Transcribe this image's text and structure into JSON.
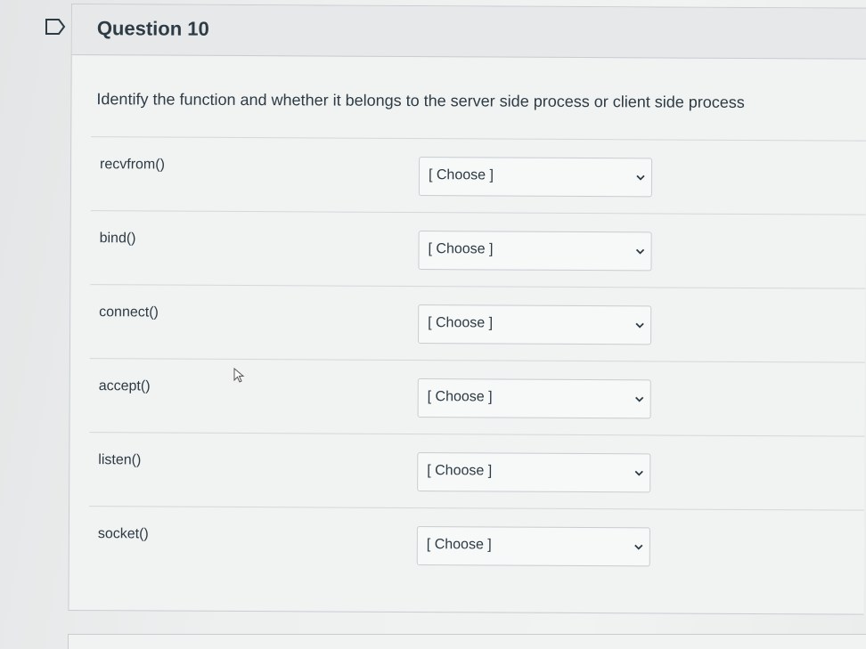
{
  "question": {
    "title": "Question 10",
    "prompt": "Identify the function and whether it belongs to the server side process or client side process"
  },
  "rows": [
    {
      "label": "recvfrom()",
      "selected": "[ Choose ]"
    },
    {
      "label": "bind()",
      "selected": "[ Choose ]"
    },
    {
      "label": "connect()",
      "selected": "[ Choose ]"
    },
    {
      "label": "accept()",
      "selected": "[ Choose ]"
    },
    {
      "label": "listen()",
      "selected": "[ Choose ]"
    },
    {
      "label": "socket()",
      "selected": "[ Choose ]"
    }
  ],
  "icons": {
    "flag": "bookmark-flag-icon",
    "dropdown": "chevron-down-icon",
    "cursor": "mouse-pointer-icon"
  },
  "colors": {
    "text": "#2d3b45",
    "border": "#c7cdd1",
    "background": "#f1f2f2"
  }
}
